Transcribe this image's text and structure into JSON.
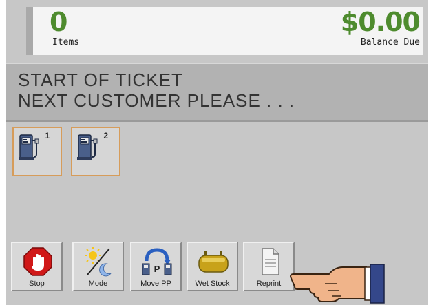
{
  "header": {
    "items_count": "0",
    "items_label": "Items",
    "balance_value": "$0.00",
    "balance_label": "Balance Due"
  },
  "message": {
    "line1": "START OF TICKET",
    "line2": "NEXT CUSTOMER PLEASE . . ."
  },
  "pumps": [
    {
      "number": "1",
      "icon": "fuel-pump-icon"
    },
    {
      "number": "2",
      "icon": "fuel-pump-icon"
    }
  ],
  "buttons": {
    "stop": {
      "label": "Stop",
      "icon": "stop-hand-icon"
    },
    "mode": {
      "label": "Mode",
      "icon": "sun-moon-icon"
    },
    "move_pp": {
      "label": "Move PP",
      "icon": "move-prepay-icon"
    },
    "wet_stock": {
      "label": "Wet Stock",
      "icon": "fuel-tank-icon"
    },
    "reprint": {
      "label": "Reprint",
      "icon": "document-icon"
    }
  },
  "colors": {
    "accent_green": "#4e8b2e",
    "background": "#c7c7c7",
    "pump_border": "#d69c5a"
  }
}
